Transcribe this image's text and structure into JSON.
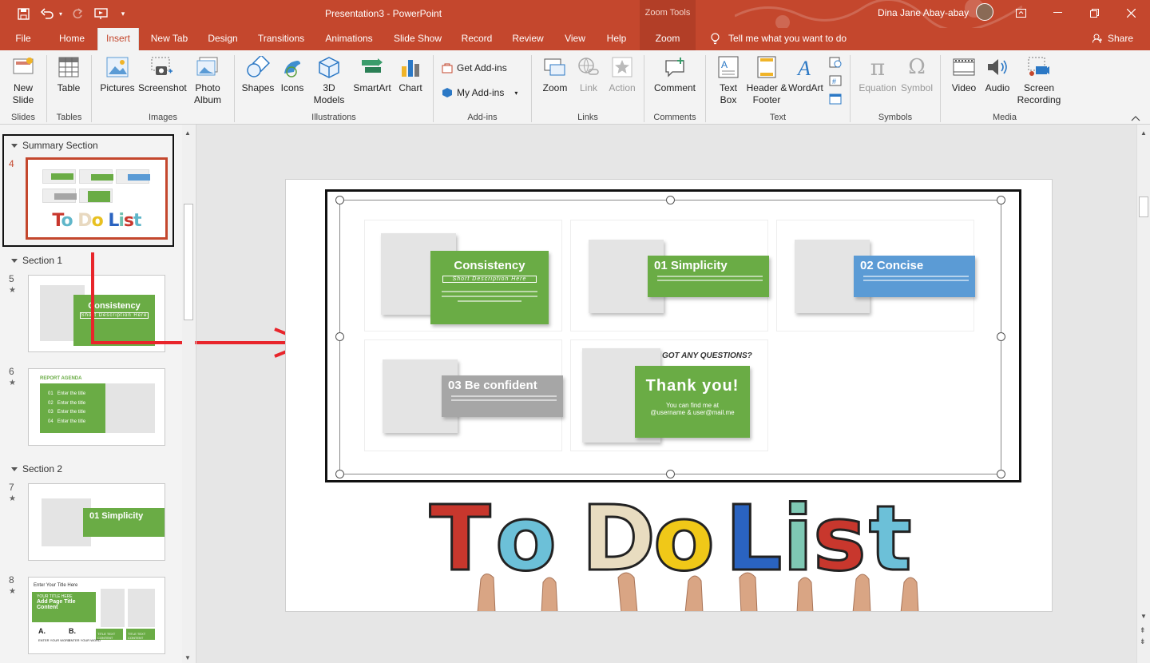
{
  "titlebar": {
    "doc_title": "Presentation3 - PowerPoint",
    "context_tab": "Zoom Tools",
    "user_name": "Dina Jane Abay-abay"
  },
  "tabs": [
    "File",
    "Home",
    "Insert",
    "New Tab",
    "Design",
    "Transitions",
    "Animations",
    "Slide Show",
    "Record",
    "Review",
    "View",
    "Help",
    "Zoom"
  ],
  "active_tab": "Insert",
  "tell_me": "Tell me what you want to do",
  "share_label": "Share",
  "ribbon": {
    "slides": {
      "label": "Slides",
      "new_slide": "New Slide"
    },
    "tables": {
      "label": "Tables",
      "table": "Table"
    },
    "images": {
      "label": "Images",
      "pictures": "Pictures",
      "screenshot": "Screenshot",
      "photo_album": "Photo Album"
    },
    "illustrations": {
      "label": "Illustrations",
      "shapes": "Shapes",
      "icons": "Icons",
      "models_3d": "3D Models",
      "smartart": "SmartArt",
      "chart": "Chart"
    },
    "addins": {
      "label": "Add-ins",
      "get": "Get Add-ins",
      "my": "My Add-ins"
    },
    "links": {
      "label": "Links",
      "zoom": "Zoom",
      "link": "Link",
      "action": "Action"
    },
    "comments": {
      "label": "Comments",
      "comment": "Comment"
    },
    "text": {
      "label": "Text",
      "textbox": "Text Box",
      "header_footer": "Header & Footer",
      "wordart": "WordArt"
    },
    "symbols": {
      "label": "Symbols",
      "equation": "Equation",
      "symbol": "Symbol"
    },
    "media": {
      "label": "Media",
      "video": "Video",
      "audio": "Audio",
      "screen_recording": "Screen Recording"
    }
  },
  "thumbnails": {
    "sections": [
      "Summary Section",
      "Section 1",
      "Section 2"
    ],
    "slides": [
      {
        "num": "4",
        "title": "To Do List"
      },
      {
        "num": "5",
        "title": "Consistency",
        "subtitle": "Short Description Here"
      },
      {
        "num": "6",
        "title": "REPORT AGENDA",
        "items": [
          {
            "n": "01",
            "t": "Enter the title"
          },
          {
            "n": "02",
            "t": "Enter the title"
          },
          {
            "n": "03",
            "t": "Enter the title"
          },
          {
            "n": "04",
            "t": "Enter the title"
          }
        ]
      },
      {
        "num": "7",
        "title": "01 Simplicity"
      },
      {
        "num": "8",
        "title": "Enter Your Title Here",
        "sub": "YOUR TITLE HERE",
        "main": "Add Page Title Content",
        "a": "A.",
        "b": "B.",
        "a_label": "ENTER YOUR WORD",
        "b_label": "ENTER YOUR WORD",
        "box_label": "TITLE TEXT CONTENT"
      }
    ]
  },
  "slide": {
    "cards": [
      {
        "title": "Consistency",
        "subtitle": "Short Description Here"
      },
      {
        "title": "01 Simplicity"
      },
      {
        "title": "02 Concise"
      },
      {
        "title": "03 Be confident"
      },
      {
        "title": "Thank you!",
        "top": "GOT ANY QUESTIONS?",
        "line1": "You can find me at",
        "line2": "@username & user@mail.me"
      }
    ],
    "wordart": "To Do List"
  },
  "colors": {
    "accent": "#c4472d",
    "green": "#6aac45",
    "blue": "#5b9bd5",
    "gray": "#a6a6a6"
  }
}
